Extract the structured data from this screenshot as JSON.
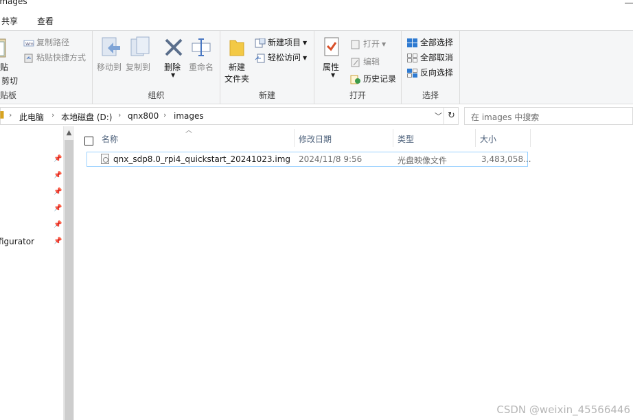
{
  "window": {
    "title": "images"
  },
  "tabs": [
    {
      "label": "共享"
    },
    {
      "label": "查看"
    }
  ],
  "ribbon": {
    "clipboard": {
      "paste": "贴",
      "cut": "剪切",
      "copy_path": "复制路径",
      "paste_shortcut": "粘贴快捷方式",
      "group": "贴板"
    },
    "organize": {
      "move_to": "移动到",
      "copy_to": "复制到",
      "delete": "删除",
      "rename": "重命名",
      "group": "组织"
    },
    "new": {
      "new_folder_line1": "新建",
      "new_folder_line2": "文件夹",
      "new_item": "新建项目",
      "easy_access": "轻松访问",
      "group": "新建"
    },
    "open": {
      "properties": "属性",
      "open": "打开",
      "edit": "编辑",
      "history": "历史记录",
      "group": "打开"
    },
    "select": {
      "select_all": "全部选择",
      "select_none": "全部取消",
      "invert": "反向选择",
      "group": "选择"
    }
  },
  "address": {
    "crumbs": [
      "此电脑",
      "本地磁盘 (D:)",
      "qnx800",
      "images"
    ]
  },
  "search": {
    "placeholder": "在 images 中搜索"
  },
  "nav": {
    "visible_item": "figurator"
  },
  "columns": [
    "名称",
    "修改日期",
    "类型",
    "大小"
  ],
  "files": [
    {
      "name": "qnx_sdp8.0_rpi4_quickstart_20241023.img",
      "modified": "2024/11/8 9:56",
      "type": "光盘映像文件",
      "size": "3,483,058..."
    }
  ],
  "watermark": "CSDN @weixin_45566446",
  "colors": {
    "accent": "#0078d7",
    "selection_border": "#99d1ff",
    "header_text": "#4c607a"
  }
}
